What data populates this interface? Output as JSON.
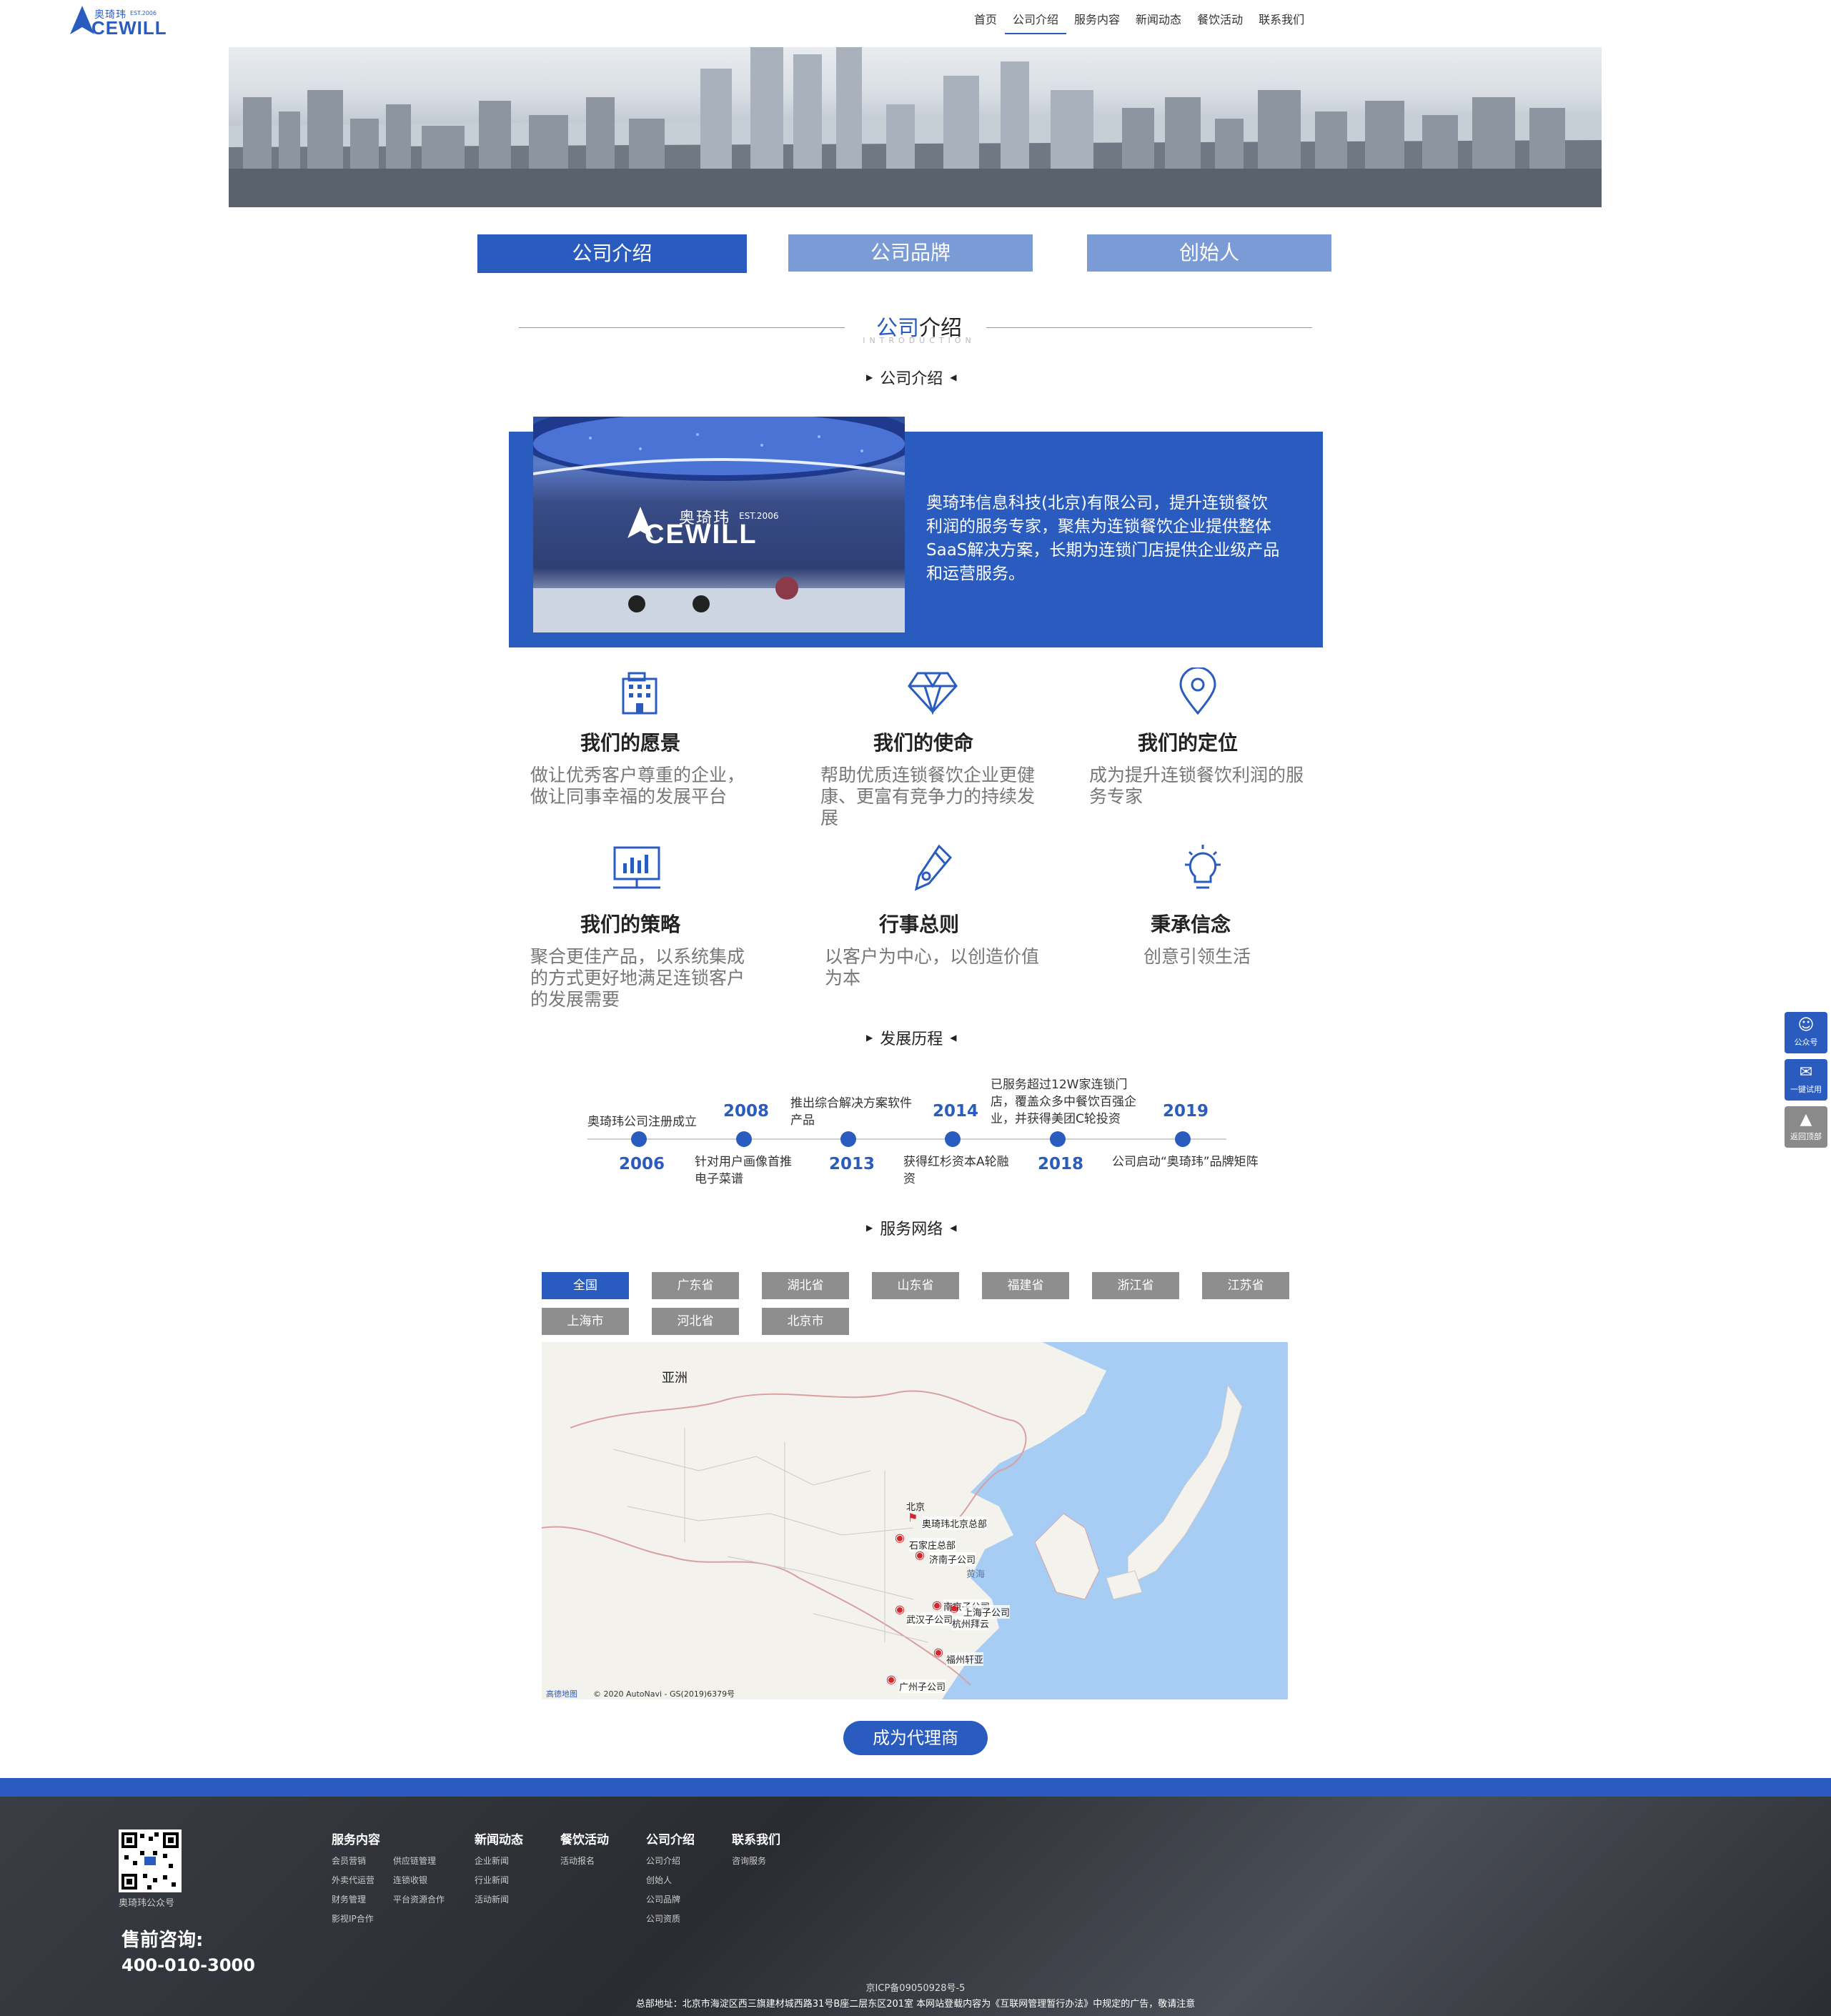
{
  "header": {
    "logo_cn": "奥琦玮",
    "logo_est": "EST.2006",
    "logo_en": "CEWILL",
    "nav": [
      "首页",
      "公司介绍",
      "服务内容",
      "新闻动态",
      "餐饮活动",
      "联系我们"
    ]
  },
  "tabs": [
    "公司介绍",
    "公司品牌",
    "创始人"
  ],
  "section": {
    "title_blue": "公司",
    "title_rest": "介绍",
    "title_en": "INTRODUCTION"
  },
  "subheads": {
    "intro": "公司介绍",
    "history": "发展历程",
    "network": "服务网络"
  },
  "intro": {
    "photo_logo_cn": "奥琦玮",
    "photo_logo_est": "EST.2006",
    "photo_logo_en": "CEWILL",
    "text": "奥琦玮信息科技(北京)有限公司，提升连锁餐饮利润的服务专家，聚焦为连锁餐饮企业提供整体SaaS解决方案，长期为连锁门店提供企业级产品和运营服务。"
  },
  "values": [
    {
      "icon": "building-icon",
      "title": "我们的愿景",
      "text": "做让优秀客户尊重的企业，做让同事幸福的发展平台"
    },
    {
      "icon": "diamond-icon",
      "title": "我们的使命",
      "text": "帮助优质连锁餐饮企业更健康、更富有竞争力的持续发展"
    },
    {
      "icon": "location-icon",
      "title": "我们的定位",
      "text": "成为提升连锁餐饮利润的服务专家"
    },
    {
      "icon": "monitor-chart-icon",
      "title": "我们的策略",
      "text": "聚合更佳产品，以系统集成的方式更好地满足连锁客户的发展需要"
    },
    {
      "icon": "pen-icon",
      "title": "行事总则",
      "text": "以客户为中心，以创造价值为本"
    },
    {
      "icon": "lightbulb-icon",
      "title": "秉承信念",
      "text": "创意引领生活"
    }
  ],
  "timeline": [
    {
      "year": "2006",
      "text": "奥琦玮公司注册成立"
    },
    {
      "year": "2008",
      "text": "针对用户画像首推电子菜谱"
    },
    {
      "year": "2013",
      "text": "推出综合解决方案软件产品"
    },
    {
      "year": "2014",
      "text": "获得红杉资本A轮融资"
    },
    {
      "year": "2018",
      "text": "已服务超过12W家连锁门店，覆盖众多中餐饮百强企业，并获得美团C轮投资"
    },
    {
      "year": "2019",
      "text": "公司启动“奥琦玮”品牌矩阵"
    }
  ],
  "regions": [
    "全国",
    "广东省",
    "湖北省",
    "山东省",
    "福建省",
    "浙江省",
    "江苏省",
    "上海市",
    "河北省",
    "北京市"
  ],
  "map": {
    "continent": "亚洲",
    "beijing": "北京",
    "sea": "黄海",
    "labels": [
      "奥琦玮北京总部",
      "石家庄总部",
      "济南子公司",
      "武汉子公司",
      "南京子公司",
      "上海子公司",
      "杭州拜云",
      "福州轩亚",
      "广州子公司"
    ],
    "copyright": "© 2020 AutoNavi - GS(2019)6379号",
    "provider": "高德地图"
  },
  "agent_button": "成为代理商",
  "side": [
    {
      "icon": "wechat-icon",
      "label": "公众号"
    },
    {
      "icon": "chat-icon",
      "label": "一键试用"
    },
    {
      "icon": "top-icon",
      "label": "返回顶部"
    }
  ],
  "footer": {
    "qr_caption": "奥琦玮公众号",
    "presale_label": "售前咨询:",
    "phone": "400-010-3000",
    "columns": [
      {
        "title": "服务内容",
        "items": [
          "会员营销",
          "供应链管理",
          "外卖代运营",
          "连锁收银",
          "财务管理",
          "平台资源合作",
          "影视IP合作"
        ]
      },
      {
        "title": "新闻动态",
        "items": [
          "企业新闻",
          "行业新闻",
          "活动新闻"
        ]
      },
      {
        "title": "餐饮活动",
        "items": [
          "活动报名"
        ]
      },
      {
        "title": "公司介绍",
        "items": [
          "公司介绍",
          "创始人",
          "公司品牌",
          "公司资质"
        ]
      },
      {
        "title": "联系我们",
        "items": [
          "咨询服务"
        ]
      }
    ],
    "beian": "京ICP备09050928号-5",
    "address": "总部地址：北京市海淀区西三旗建材城西路31号B座二层东区201室 本网站登载内容为《互联网管理暂行办法》中规定的广告，敬请注意"
  },
  "colors": {
    "brand_blue": "#2a5cc0",
    "light_blue": "#7a9bd6",
    "gray_button": "#8e8e8e",
    "footer_dark": "#2f3237"
  }
}
